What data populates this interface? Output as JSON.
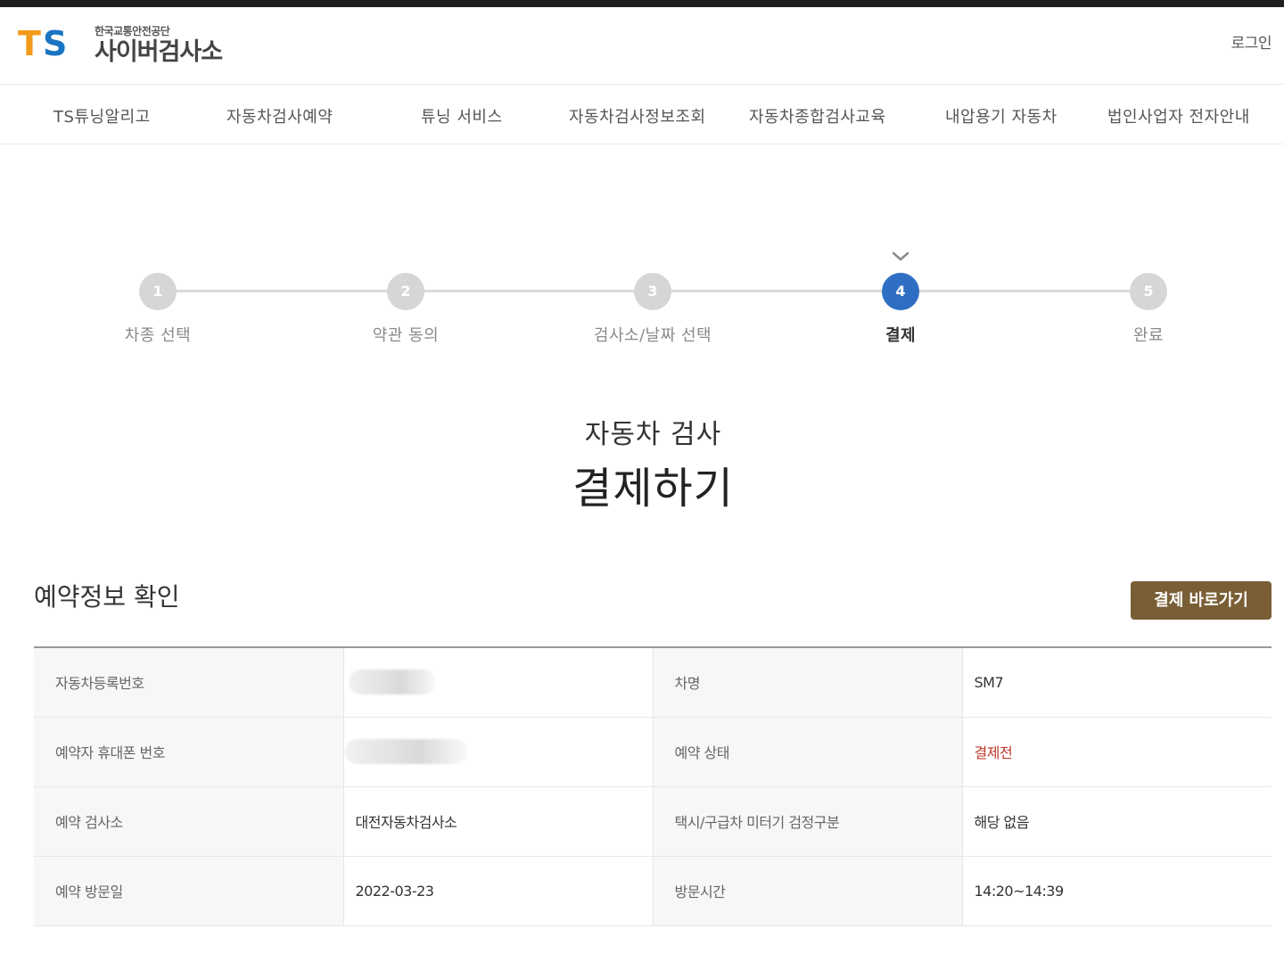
{
  "header": {
    "org_name": "한국교통안전공단",
    "site_name": "사이버검사소",
    "login_label": "로그인"
  },
  "nav": {
    "items": [
      {
        "label": "TS튜닝알리고"
      },
      {
        "label": "자동차검사예약"
      },
      {
        "label": "튜닝 서비스"
      },
      {
        "label": "자동차검사정보조회"
      },
      {
        "label": "자동차종합검사교육"
      },
      {
        "label": "내압용기 자동차"
      },
      {
        "label": "법인사업자 전자안내"
      }
    ]
  },
  "stepper": {
    "current": 4,
    "steps": [
      {
        "number": "1",
        "label": "차종 선택"
      },
      {
        "number": "2",
        "label": "약관 동의"
      },
      {
        "number": "3",
        "label": "검사소/날짜 선택"
      },
      {
        "number": "4",
        "label": "결제"
      },
      {
        "number": "5",
        "label": "완료"
      }
    ]
  },
  "title": {
    "sub": "자동차 검사",
    "main": "결제하기"
  },
  "reservation": {
    "section_title": "예약정보 확인",
    "pay_button_label": "결제 바로가기",
    "rows": [
      {
        "label1": "자동차등록번호",
        "value1": "",
        "label2": "차명",
        "value2": "SM7"
      },
      {
        "label1": "예약자 휴대폰 번호",
        "value1": "",
        "label2": "예약 상태",
        "value2": "결제전"
      },
      {
        "label1": "예약 검사소",
        "value1": "대전자동차검사소",
        "label2": "택시/구급차 미터기 검정구분",
        "value2": "해당 없음"
      },
      {
        "label1": "예약 방문일",
        "value1": "2022-03-23",
        "label2": "방문시간",
        "value2": "14:20~14:39"
      }
    ],
    "status_color": "#c0392b"
  },
  "colors": {
    "accent_blue": "#2f6fc3",
    "button_brown": "#7a5f36",
    "logo_orange": "#f29a1a",
    "logo_blue": "#1a74c2"
  }
}
